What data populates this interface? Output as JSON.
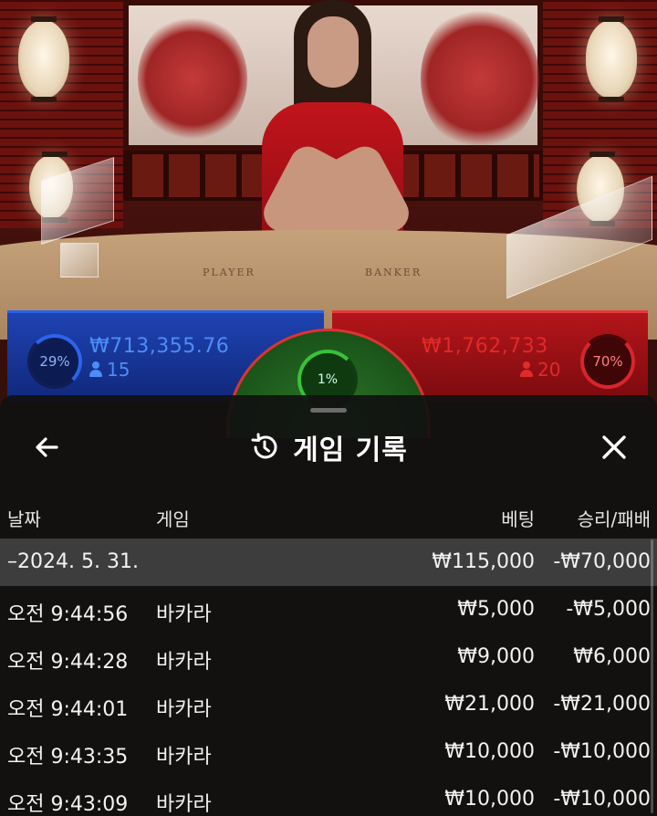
{
  "stream": {
    "table_player_label": "PLAYER",
    "table_banker_label": "BANKER"
  },
  "betting": {
    "player": {
      "percent": "29%",
      "amount": "₩713,355.76",
      "bettors": "15",
      "color": "#2a62e6"
    },
    "tie": {
      "percent": "1%",
      "color": "#39c13b"
    },
    "banker": {
      "percent": "70%",
      "amount": "₩1,762,733",
      "bettors": "20",
      "color": "#d8262a"
    }
  },
  "history_sheet": {
    "title": "게임 기록",
    "icons": {
      "back": "arrow-left-icon",
      "history": "history-clock-icon",
      "close": "close-x-icon"
    },
    "columns": {
      "date": "날짜",
      "game": "게임",
      "bet": "베팅",
      "win_loss": "승리/패배"
    },
    "date_group": {
      "date": "–2024. 5. 31.",
      "bet": "₩115,000",
      "win_loss": "-₩70,000"
    },
    "rows": [
      {
        "time": "오전 9:44:56",
        "game": "바카라",
        "bet": "₩5,000",
        "win_loss": "-₩5,000"
      },
      {
        "time": "오전 9:44:28",
        "game": "바카라",
        "bet": "₩9,000",
        "win_loss": "₩6,000"
      },
      {
        "time": "오전 9:44:01",
        "game": "바카라",
        "bet": "₩21,000",
        "win_loss": "-₩21,000"
      },
      {
        "time": "오전 9:43:35",
        "game": "바카라",
        "bet": "₩10,000",
        "win_loss": "-₩10,000"
      },
      {
        "time": "오전 9:43:09",
        "game": "바카라",
        "bet": "₩10,000",
        "win_loss": "-₩10,000"
      }
    ]
  }
}
